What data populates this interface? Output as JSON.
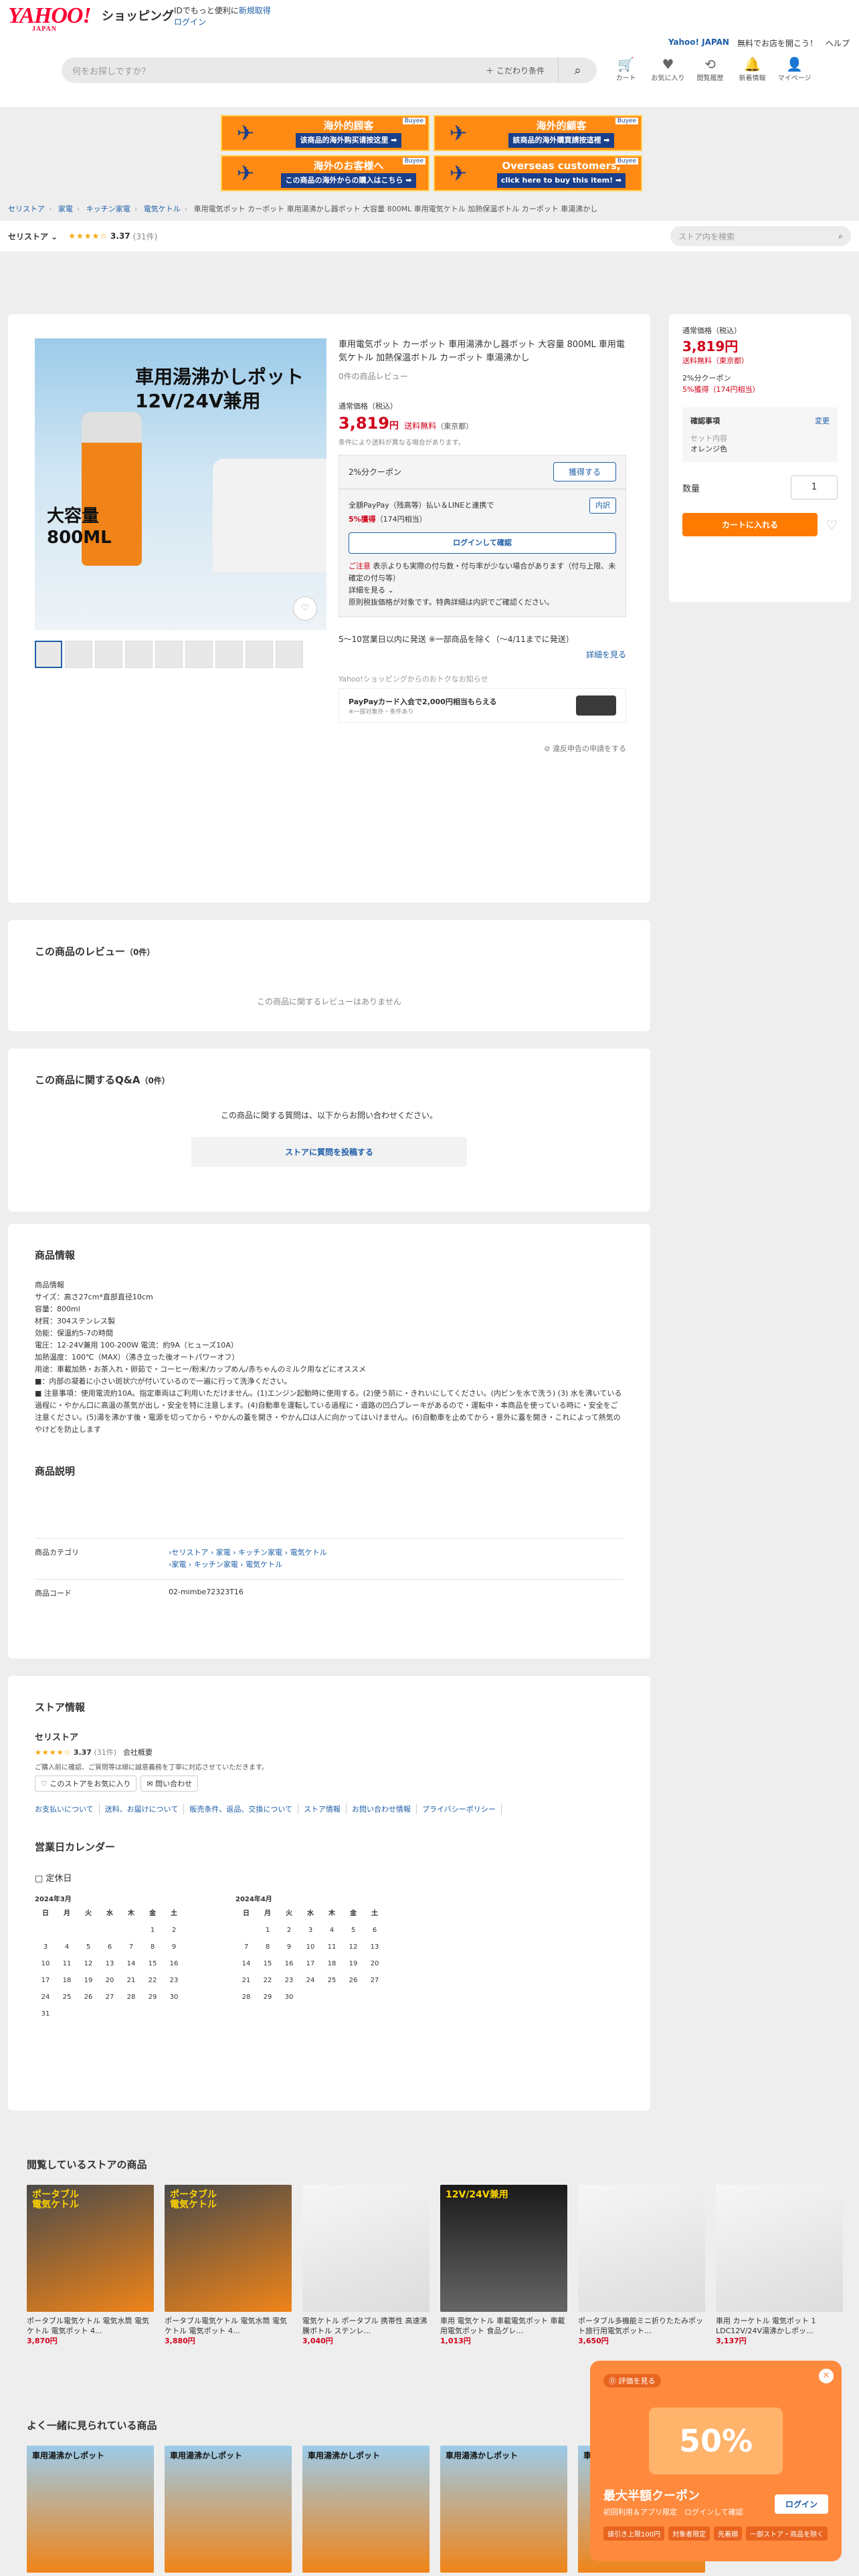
{
  "header": {
    "logo": "YAHOO!",
    "logo_sub": "JAPAN",
    "service": "ショッピング",
    "id_msg_prefix": "IDでもっと便利に",
    "register": "新規取得",
    "login": "ログイン",
    "links": [
      "Yahoo! JAPAN",
      "無料でお店を開こう！",
      "ヘルプ"
    ],
    "search_placeholder": "何をお探しですか？",
    "condition": "＋ こだわり条件",
    "icons": [
      {
        "label": "カート",
        "icon": "cart-icon",
        "glyph": "🛒"
      },
      {
        "label": "お気に入り",
        "icon": "heart-icon",
        "glyph": "♥"
      },
      {
        "label": "閲覧履歴",
        "icon": "history-icon",
        "glyph": "⟲"
      },
      {
        "label": "新着情報",
        "icon": "bell-icon",
        "glyph": "🔔"
      },
      {
        "label": "マイページ",
        "icon": "person-icon",
        "glyph": "👤"
      }
    ]
  },
  "banners": [
    {
      "l1": "海外的顾客",
      "l2": "该商品的海外购买请按这里 ➡",
      "tag": "Buyee"
    },
    {
      "l1": "海外的顧客",
      "l2": "該商品的海外購買請按這裡 ➡",
      "tag": "Buyee"
    },
    {
      "l1": "海外のお客様へ",
      "l2": "この商品の海外からの購入はこちら ➡",
      "tag": "Buyee"
    },
    {
      "l1": "Overseas customers,",
      "l2": "click here to buy this item! ➡",
      "tag": "Buyee"
    }
  ],
  "breadcrumb": [
    "セリストア",
    "家電",
    "キッチン家電",
    "電気ケトル",
    "車用電気ポット カーポット 車用湯沸かし器ボット 大容量 800ML 車用電気ケトル 加熱保温ボトル カーポット 車湯沸かし"
  ],
  "store": {
    "name": "セリストア ⌄",
    "stars": "★★★★☆",
    "rating": "3.37",
    "count": "(31件)",
    "search_placeholder": "ストア内を検索"
  },
  "product": {
    "image_title": "車用湯沸かしポット\n12V/24V兼用",
    "image_cap": "大容量\n800ML",
    "title": "車用電気ポット カーポット 車用湯沸かし器ボット 大容量 800ML 車用電気ケトル 加熱保温ボトル カーポット 車湯沸かし",
    "reviews": "0件の商品レビュー",
    "price_label": "通常価格（税込）",
    "price": "3,819",
    "yen": "円",
    "shipping": "送料無料",
    "shipping_loc": "（東京都）",
    "note": "条件により送料が異なる場合があります。",
    "coupon": "2%分クーポン",
    "coupon_btn": "獲得する",
    "pay_line": "全額PayPay（残高等）払い＆LINEと連携で",
    "pay_detail": "内訳",
    "pay_pct": "5%獲得",
    "pay_pts": "（174円相当）",
    "login_btn": "ログインして確認",
    "caution_red": "ご注意",
    "caution": "表示よりも実際の付与数・付与率が少ない場合があります（付与上限、未確定の付与等）",
    "detail_more": "詳細を見る ⌄",
    "caution2": "原則税抜価格が対象です。特典詳細は内訳でご確認ください。",
    "ship_info": "5〜10営業日以内に発送 ※一部商品を除く（〜4/11までに発送）",
    "ship_more": "詳細を見る",
    "notice": "Yahoo!ショッピングからのおトクなお知らせ",
    "card_line1": "PayPayカード入会で2,000円相当もらえる",
    "card_line2": "※一部対象外・条件あり",
    "report": "⊘ 違反申告の申請をする"
  },
  "side": {
    "label": "通常価格（税込）",
    "price": "3,819円",
    "shipping": "送料無料（東京都）",
    "coupon": "2%分クーポン",
    "pts": "5%獲得（174円相当）",
    "opt_title": "確認事項",
    "opt_change": "変更",
    "opt_key": "セット内容",
    "opt_val": "オレンジ色",
    "qty_label": "数量",
    "qty": "1",
    "cart": "カートに入れる"
  },
  "review_sec": {
    "title": "この商品のレビュー",
    "count": "（0件）",
    "empty": "この商品に関するレビューはありません"
  },
  "qa_sec": {
    "title": "この商品に関するQ&A",
    "count": "（0件）",
    "msg": "この商品に関する質問は、以下からお問い合わせください。",
    "btn": "ストアに質問を投稿する"
  },
  "info_sec": {
    "title": "商品情報",
    "spec": "商品情報\nサイズ：高さ27cm*直部直径10cm\n容量：800ml\n材質：304ステンレス製\n効能：保温約5-7の時間\n電圧：12-24V兼用 100-200W 電流：約9A（ヒューズ10A）\n加熱温度：100℃（MAX）（沸き立った後オートパワーオフ）\n用途：車載加熱・お茶入れ・卵茹で・コーヒー/粉末/カップめん/赤ちゃんのミルク用などにオススメ\n■：内部の凝着に小さい斑状穴が付いているので一遍に行って洗浄ください。\n■ 注意事項：使用電流約10A。指定車両はご利用いただけません。(1)エンジン起動時に使用する。(2)使う前に・きれいにしてください。(内ビンを水で洗う) (3) 水を沸いている過程に・やかん口に高温の蒸気が出し・安全を特に注意します。(4)自動車を運転している過程に・道路の凹凸ブレーキがあるので・運転中・本商品を使っている時に・安全をご注意ください。(5)湯を沸かす後・電源を切ってから・やかんの蓋を開き・やかん口は人に向かってはいけません。(6)自動車を止めてから・意外に蓋を開き・これによって熱気のやけどを防止します",
    "desc_title": "商品説明",
    "cat_key": "商品カテゴリ",
    "cat1": "›セリストア › 家電 › キッチン家電 › 電気ケトル",
    "cat2": "›家電 › キッチン家電 › 電気ケトル",
    "code_key": "商品コード",
    "code": "02-mimbe72323T16"
  },
  "store_sec": {
    "title": "ストア情報",
    "name": "セリストア",
    "stars": "★★★★☆",
    "rating": "3.37",
    "count": "(31件)",
    "company": "会社概要",
    "msg": "ご購入前に確認、ご質問等は順に誠意義務を丁寧に対応させていただきます。",
    "fav": "♡ このストアをお気に入り",
    "contact": "✉ 問い合わせ",
    "links": [
      "お支払いについて",
      "送料、お届けについて",
      "販売条件、返品、交換について",
      "ストア情報",
      "お問い合わせ情報",
      "プライバシーポリシー"
    ],
    "cal_title": "営業日カレンダー",
    "legend": "□ 定休日",
    "weekdays": [
      "日",
      "月",
      "火",
      "水",
      "木",
      "金",
      "土"
    ],
    "months": [
      {
        "name": "2024年3月",
        "days": [
          "",
          "",
          "",
          "",
          "",
          "1",
          "2",
          "3",
          "4",
          "5",
          "6",
          "7",
          "8",
          "9",
          "10",
          "11",
          "12",
          "13",
          "14",
          "15",
          "16",
          "17",
          "18",
          "19",
          "20",
          "21",
          "22",
          "23",
          "24",
          "25",
          "26",
          "27",
          "28",
          "29",
          "30",
          "31"
        ]
      },
      {
        "name": "2024年4月",
        "days": [
          "",
          "1",
          "2",
          "3",
          "4",
          "5",
          "6",
          "7",
          "8",
          "9",
          "10",
          "11",
          "12",
          "13",
          "14",
          "15",
          "16",
          "17",
          "18",
          "19",
          "20",
          "21",
          "22",
          "23",
          "24",
          "25",
          "26",
          "27",
          "28",
          "29",
          "30"
        ]
      }
    ]
  },
  "reco1": {
    "title": "閲覧しているストアの商品",
    "items": [
      {
        "name": "ポータブル電気ケトル 電気水筒 電気ケトル 電気ポット 4...",
        "price": "3,870円",
        "cap": "ポータブル\n電気ケトル"
      },
      {
        "name": "ポータブル電気ケトル 電気水筒 電気ケトル 電気ポット 4...",
        "price": "3,880円",
        "cap": "ポータブル\n電気ケトル"
      },
      {
        "name": "電気ケトル ポータブル 携帯性 高速沸騰ボトル ステンレ...",
        "price": "3,040円",
        "cap": ""
      },
      {
        "name": "車用 電気ケトル 車載電気ポット 車載用電気ポット 食品グレ...",
        "price": "1,013円",
        "cap": "12V/24V兼用"
      },
      {
        "name": "ポータブル多機能ミニ折りたたみポット旅行用電気ポット...",
        "price": "3,650円",
        "cap": ""
      },
      {
        "name": "車用 カーケトル 電気ポット 1 LDC12V/24V湯沸かしポッ...",
        "price": "3,137円",
        "cap": ""
      }
    ]
  },
  "reco2": {
    "title": "よく一緒に見られている商品",
    "items": [
      {
        "cap": "車用湯沸かしポット"
      },
      {
        "cap": "車用湯沸かしポット"
      },
      {
        "cap": "車用湯沸かしポット"
      },
      {
        "cap": "車用湯沸かしポット"
      },
      {
        "cap": "車用湯沸かしポット"
      }
    ]
  },
  "popup": {
    "head": "⓪ 評価を見る",
    "pct": "50%",
    "title": "最大半額クーポン",
    "line": "初回利用＆アプリ限定　ログインして確認",
    "login": "ログイン",
    "chips": [
      "値引き上限100円",
      "対象者限定",
      "先着順",
      "一部ストア・商品を除く"
    ]
  }
}
